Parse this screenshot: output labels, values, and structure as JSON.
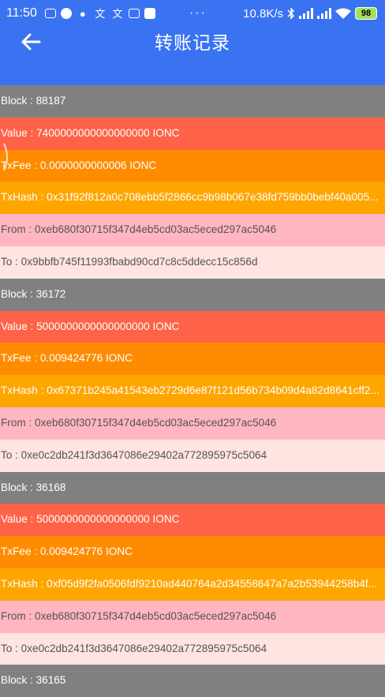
{
  "status_bar": {
    "time": "11:50",
    "left_icons": [
      "keyboard-icon",
      "circle-app-icon",
      "qq-icon",
      "translate-icon",
      "translate-icon-2",
      "calculator-icon",
      "video-app-icon"
    ],
    "overflow": "···",
    "net_speed": "10.8K/s",
    "battery": "98"
  },
  "header": {
    "title": "转账记录",
    "background": "#3a73f2"
  },
  "records": [
    {
      "block": "Block : 88187",
      "value": "Value : 7400000000000000000 IONC",
      "txfee": "TxFee : 0.0000000000006 IONC",
      "txhash": "TxHash : 0x31f92f812a0c708ebb5f2866cc9b98b067e38fd759bb0bebf40a005...",
      "from": "From : 0xeb680f30715f347d4eb5cd03ac5eced297ac5046",
      "to": "To :  0x9bbfb745f11993fbabd90cd7c8c5ddecc15c856d"
    },
    {
      "block": "Block : 36172",
      "value": "Value : 5000000000000000000 IONC",
      "txfee": "TxFee : 0.009424776 IONC",
      "txhash": "TxHash : 0x67371b245a41543eb2729d6e87f121d56b734b09d4a82d8641cff2...",
      "from": "From : 0xeb680f30715f347d4eb5cd03ac5eced297ac5046",
      "to": "To :  0xe0c2db241f3d3647086e29402a772895975c5064"
    },
    {
      "block": "Block : 36168",
      "value": "Value : 5000000000000000000 IONC",
      "txfee": "TxFee : 0.009424776 IONC",
      "txhash": "TxHash : 0xf05d9f2fa0506fdf9210ad440764a2d34558647a7a2b53944258b4f...",
      "from": "From : 0xeb680f30715f347d4eb5cd03ac5eced297ac5046",
      "to": "To :  0xe0c2db241f3d3647086e29402a772895975c5064"
    },
    {
      "block": "Block : 36165"
    }
  ],
  "colors": {
    "block": "#808080",
    "value": "#ff6347",
    "txfee": "#ff8c00",
    "txhash": "#ffa500",
    "from": "#ffb6c1",
    "to": "#ffe4e1"
  }
}
